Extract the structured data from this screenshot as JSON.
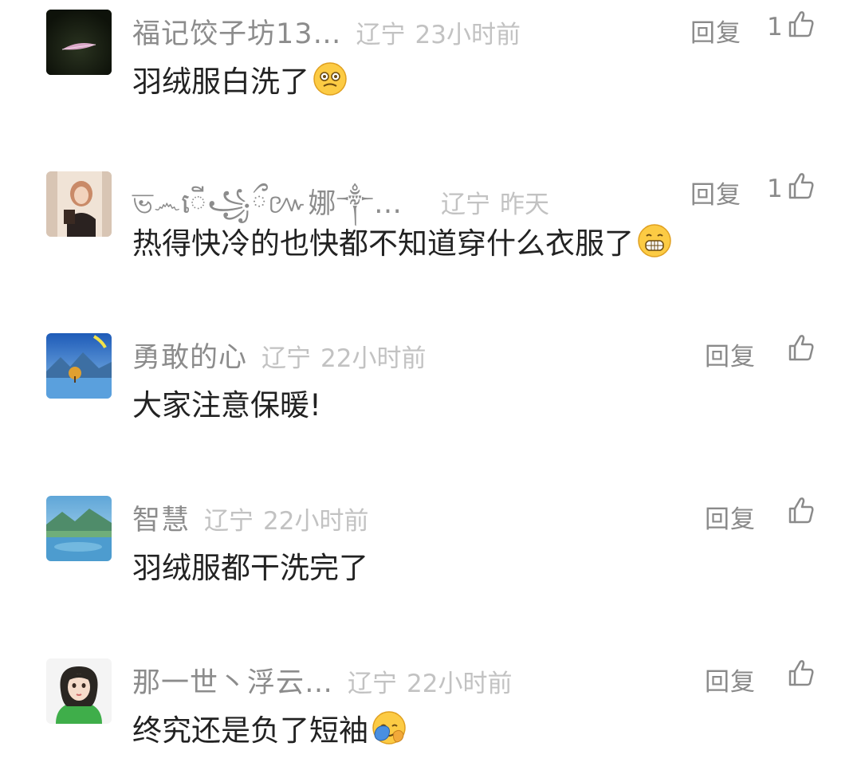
{
  "comments": [
    {
      "username": "福记饺子坊13…",
      "location": "辽宁",
      "time": "23小时前",
      "reply": "回复",
      "likes": "1",
      "text": "羽绒服白洗了",
      "emoji": "woozy-face-emoji",
      "avatar": "dark-leaf-avatar"
    },
    {
      "username": "ভ෴ើ꧁ྀ៚娜༒…",
      "location": "辽宁",
      "time": "昨天",
      "reply": "回复",
      "likes": "1",
      "text": "热得快冷的也快都不知道穿什么衣服了",
      "emoji": "grinning-face-emoji",
      "avatar": "photo-girl-avatar"
    },
    {
      "username": "勇敢的心",
      "location": "辽宁",
      "time": "22小时前",
      "reply": "回复",
      "likes": "",
      "text": "大家注意保暖!",
      "emoji": "",
      "avatar": "mountain-lake-avatar"
    },
    {
      "username": "智慧",
      "location": "辽宁",
      "time": "22小时前",
      "reply": "回复",
      "likes": "",
      "text": "羽绒服都干洗完了",
      "emoji": "",
      "avatar": "lake-landscape-avatar"
    },
    {
      "username": "那一世丶浮云…",
      "location": "辽宁",
      "time": "22小时前",
      "reply": "回复",
      "likes": "",
      "text": "终究还是负了短袖",
      "emoji": "facepalm-emoji",
      "avatar": "cartoon-girl-avatar"
    }
  ],
  "colors": {
    "username": "#8c8c8c",
    "meta": "#c2c2c2",
    "text": "#222222",
    "action": "#8a8a8a"
  }
}
